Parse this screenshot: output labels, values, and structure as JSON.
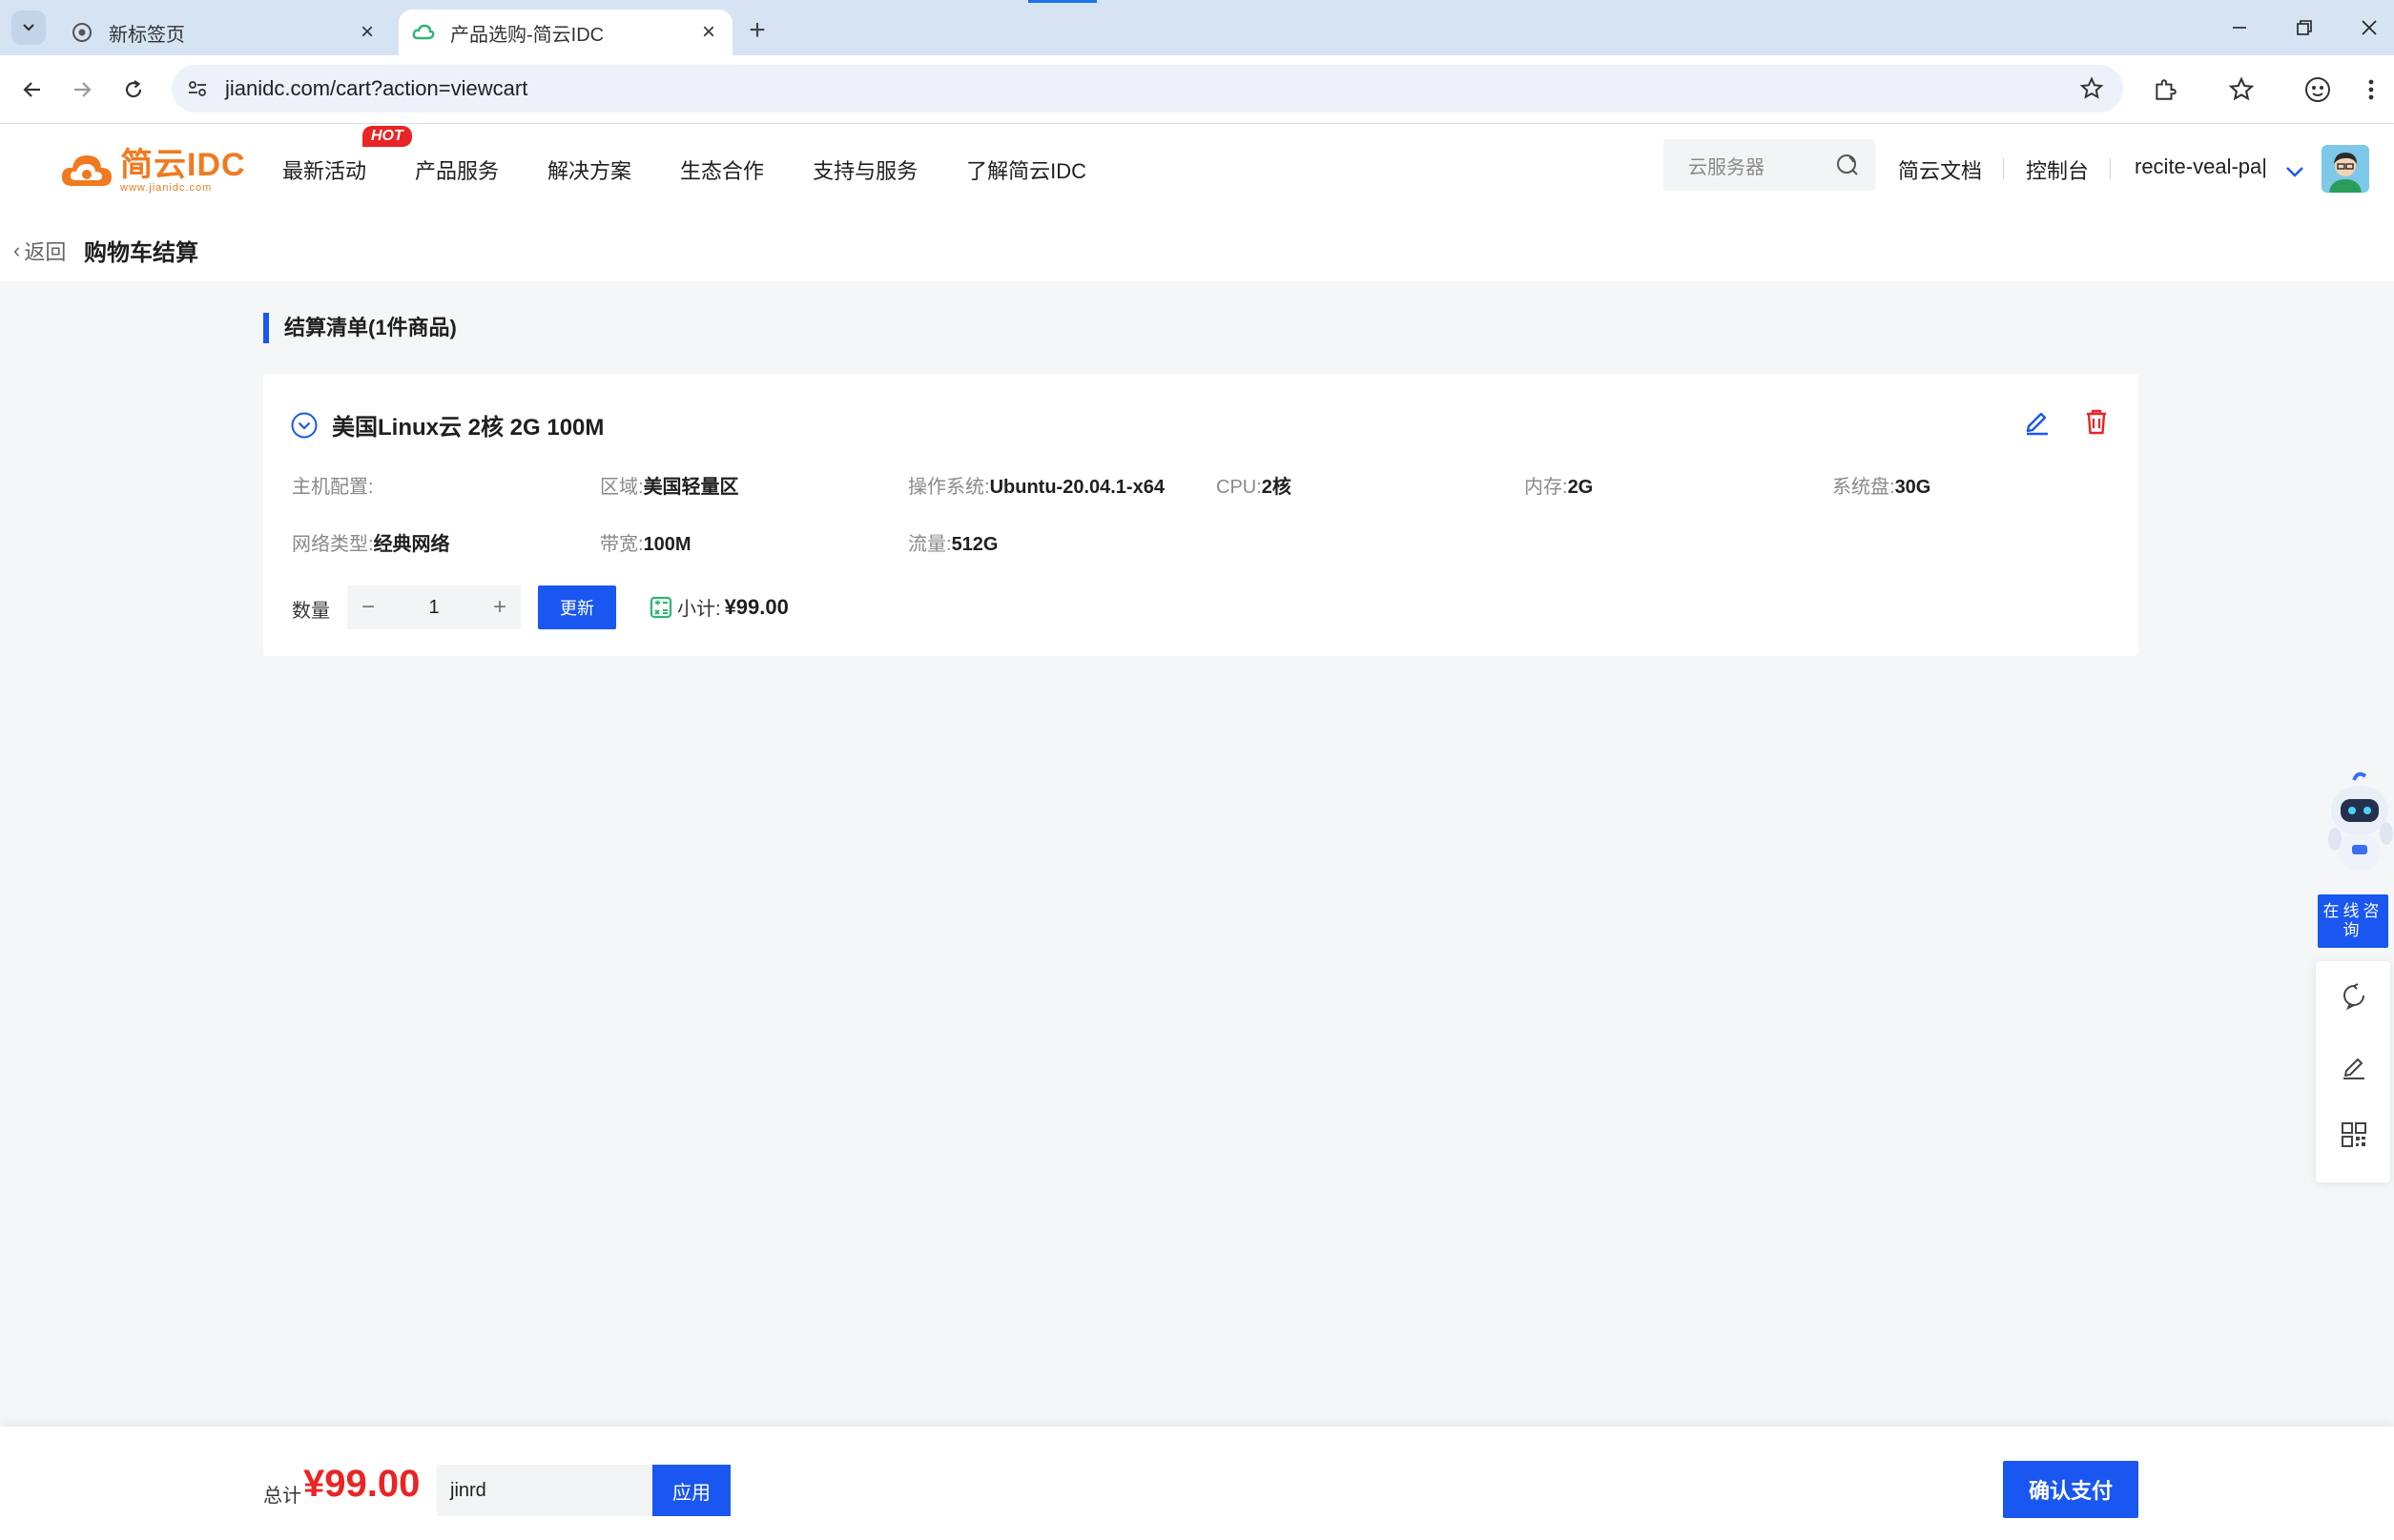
{
  "browser": {
    "tabs": [
      {
        "title": "新标签页",
        "active": false
      },
      {
        "title": "产品选购-简云IDC",
        "active": true
      }
    ],
    "url": "jianidc.com/cart?action=viewcart"
  },
  "site": {
    "logo": {
      "main": "简云IDC",
      "sub": "www.jianidc.com",
      "color": "#f07a1f"
    },
    "nav": [
      "最新活动",
      "产品服务",
      "解决方案",
      "生态合作",
      "支持与服务",
      "了解简云IDC"
    ],
    "hot_badge": "HOT",
    "search_placeholder": "云服务器",
    "links": {
      "docs": "简云文档",
      "console": "控制台"
    },
    "username": "recite-veal-pa|"
  },
  "breadcrumb": {
    "back": "返回",
    "title": "购物车结算"
  },
  "section_title": "结算清单(1件商品)",
  "product": {
    "name": "美国Linux云 2核 2G 100M",
    "specs": {
      "host_config": {
        "label": "主机配置:",
        "value": ""
      },
      "region": {
        "label": "区域:",
        "value": "美国轻量区"
      },
      "os": {
        "label": "操作系统:",
        "value": "Ubuntu-20.04.1-x64"
      },
      "cpu": {
        "label": "CPU:",
        "value": "2核"
      },
      "memory": {
        "label": "内存:",
        "value": "2G"
      },
      "disk": {
        "label": "系统盘:",
        "value": "30G"
      },
      "network": {
        "label": "网络类型:",
        "value": "经典网络"
      },
      "bandwidth": {
        "label": "带宽:",
        "value": "100M"
      },
      "traffic": {
        "label": "流量:",
        "value": "512G"
      }
    },
    "qty_label": "数量",
    "qty_minus": "−",
    "qty_value": "1",
    "qty_plus": "+",
    "update_label": "更新",
    "subtotal_label": "小计:",
    "subtotal_value": "¥99.00"
  },
  "service": {
    "consult": "在线咨询"
  },
  "footer": {
    "total_label": "总计",
    "total_amount": "¥99.00",
    "coupon_value": "jinrd",
    "apply_label": "应用",
    "pay_label": "确认支付"
  },
  "colors": {
    "primary": "#1a57f0",
    "danger": "#ea2424",
    "brand": "#f07a1f"
  }
}
